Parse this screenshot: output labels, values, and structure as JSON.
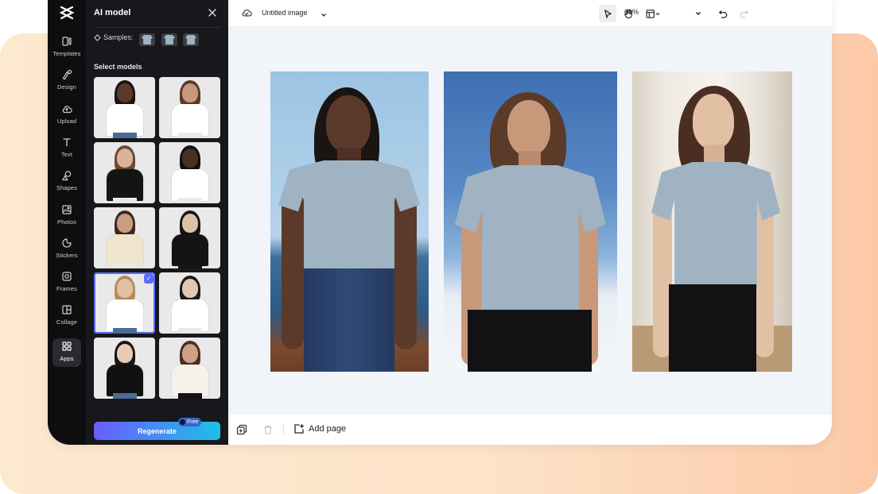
{
  "panel": {
    "title": "AI model",
    "samples_label": "Samples:",
    "select_label": "Select models",
    "regenerate_label": "Regenerate",
    "free_badge": "Free"
  },
  "rail": {
    "items": [
      {
        "label": "Templates",
        "icon": "templates-icon"
      },
      {
        "label": "Design",
        "icon": "design-icon"
      },
      {
        "label": "Upload",
        "icon": "upload-icon"
      },
      {
        "label": "Text",
        "icon": "text-icon"
      },
      {
        "label": "Shapes",
        "icon": "shapes-icon"
      },
      {
        "label": "Photos",
        "icon": "photos-icon"
      },
      {
        "label": "Stickers",
        "icon": "stickers-icon"
      },
      {
        "label": "Frames",
        "icon": "frames-icon"
      },
      {
        "label": "Collage",
        "icon": "collage-icon"
      },
      {
        "label": "Apps",
        "icon": "apps-icon",
        "active": true
      }
    ]
  },
  "models": [
    {
      "shirt": "#ffffff",
      "skin": "#5b3a2a",
      "hair": "#1a1412",
      "bottom": "#4a6a9a"
    },
    {
      "shirt": "#ffffff",
      "skin": "#c9987a",
      "hair": "#5a3a28",
      "bottom": "#e9e9ea"
    },
    {
      "shirt": "#141414",
      "skin": "#d9b39a",
      "hair": "#6b4a30",
      "bottom": "#e9e9ea"
    },
    {
      "shirt": "#ffffff",
      "skin": "#4a3024",
      "hair": "#111111",
      "bottom": "#e9e9ea"
    },
    {
      "shirt": "#efe4cc",
      "skin": "#c99e80",
      "hair": "#3a2a20",
      "bottom": "#e9e9ea"
    },
    {
      "shirt": "#141414",
      "skin": "#dcc0a8",
      "hair": "#141414",
      "bottom": "#141414"
    },
    {
      "shirt": "#ffffff",
      "skin": "#e2c0a4",
      "hair": "#b88a5a",
      "bottom": "#4a6a9a",
      "selected": true
    },
    {
      "shirt": "#ffffff",
      "skin": "#e4c7b0",
      "hair": "#1a1a1a",
      "bottom": "#e9e9ea"
    },
    {
      "shirt": "#111111",
      "skin": "#e6cbb6",
      "hair": "#1a1412",
      "bottom": "#4a6a9a"
    },
    {
      "shirt": "#f6f1ea",
      "skin": "#cfa184",
      "hair": "#4a2e22",
      "bottom": "#141414"
    }
  ],
  "topbar": {
    "document_title": "Untitled image",
    "zoom": "69%"
  },
  "bottombar": {
    "add_page_label": "Add page"
  },
  "colors": {
    "accent": "#5b6cff",
    "shirt": "#9fb3c3"
  }
}
